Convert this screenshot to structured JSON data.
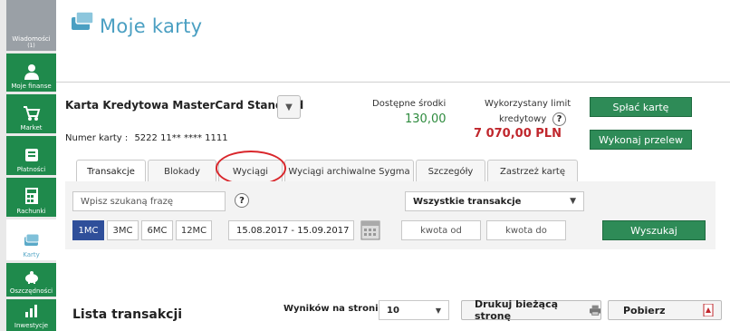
{
  "sidebar": {
    "items": [
      {
        "label": "Wiadomości",
        "sublabel": "(1)",
        "icon": "envelope-icon"
      },
      {
        "label": "Moje finanse",
        "icon": "user-icon"
      },
      {
        "label": "Market",
        "icon": "cart-icon"
      },
      {
        "label": "Płatności",
        "icon": "payment-icon"
      },
      {
        "label": "Rachunki",
        "icon": "calculator-icon"
      },
      {
        "label": "Karty",
        "icon": "card-icon"
      },
      {
        "label": "Oszczędności",
        "icon": "piggy-bank-icon"
      },
      {
        "label": "Inwestycje",
        "icon": "chart-icon"
      }
    ]
  },
  "page": {
    "title": "Moje karty"
  },
  "card": {
    "name": "Karta Kredytowa MasterCard Standard",
    "number_label": "Numer karty :",
    "number_value": "5222 11** **** 1111",
    "available_label": "Dostępne środki",
    "available_value": "130,00",
    "used_limit_label_1": "Wykorzystany limit",
    "used_limit_label_2": "kredytowy",
    "used_limit_value": "7 070,00 PLN",
    "help": "?",
    "pay_button": "Spłać kartę",
    "transfer_button": "Wykonaj przelew"
  },
  "tabs": [
    {
      "label": "Transakcje",
      "active": true
    },
    {
      "label": "Blokady",
      "active": false
    },
    {
      "label": "Wyciągi",
      "active": false
    },
    {
      "label": "Wyciągi archiwalne Sygma",
      "active": false
    },
    {
      "label": "Szczegóły",
      "active": false
    },
    {
      "label": "Zastrzeż kartę",
      "active": false
    }
  ],
  "filters": {
    "search_placeholder": "Wpisz szukaną frazę",
    "help": "?",
    "type_select": "Wszystkie transakcje",
    "periods": [
      {
        "label": "1MC",
        "active": true
      },
      {
        "label": "3MC",
        "active": false
      },
      {
        "label": "6MC",
        "active": false
      },
      {
        "label": "12MC",
        "active": false
      }
    ],
    "date_range": "15.08.2017  - 15.09.2017",
    "amount_from_placeholder": "kwota od",
    "amount_to_placeholder": "kwota do",
    "search_button": "Wyszukaj"
  },
  "list": {
    "title": "Lista transakcji",
    "per_page_label": "Wyników na stronie",
    "per_page_value": "10",
    "print_button": "Drukuj bieżącą stronę",
    "download_button": "Pobierz"
  },
  "colors": {
    "sidebar_green": "#1f8a4c",
    "accent_blue": "#4a9fc2",
    "button_green": "#2e8b57",
    "limit_red": "#c0272d",
    "annotation_red": "#d9262b"
  }
}
